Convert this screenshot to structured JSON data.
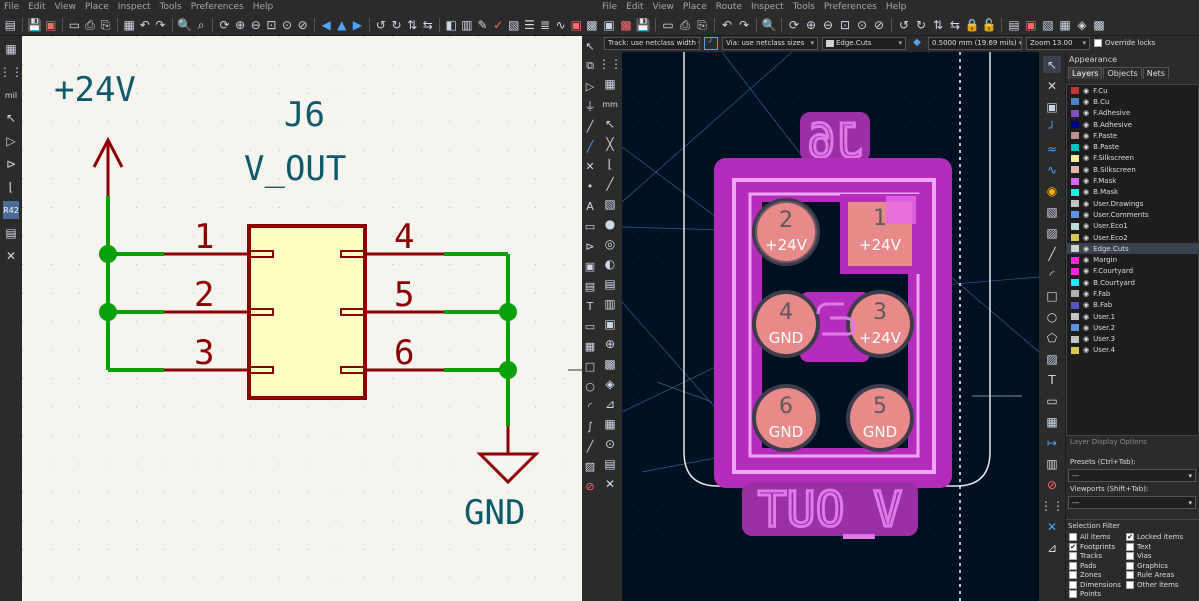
{
  "schematic": {
    "menu": [
      "File",
      "Edit",
      "View",
      "Place",
      "Inspect",
      "Tools",
      "Preferences",
      "Help"
    ],
    "power_label": "+24V",
    "ground_label": "GND",
    "ref": "J6",
    "value": "V_OUT",
    "pins": [
      "1",
      "2",
      "3",
      "4",
      "5",
      "6"
    ],
    "left_tools": [
      "grid-icon",
      "grid-dots-icon",
      "units-mil-icon",
      "cursor-icon",
      "pin-icon",
      "axis-icon",
      "erc-icon",
      "layers-icon",
      "tools-icon"
    ],
    "mil_label": "mil",
    "erc_label": "R42"
  },
  "pcb": {
    "menu": [
      "File",
      "Edit",
      "View",
      "Place",
      "Route",
      "Inspect",
      "Tools",
      "Preferences",
      "Help"
    ],
    "track_select": "Track: use netclass width",
    "via_select": "Via: use netclass sizes",
    "layer_select": "Edge.Cuts",
    "grid_select": "0.5000 mm (19.69 mils)",
    "zoom_select": "Zoom 13.00",
    "override_label": "Override locks",
    "silk_ref": "J6",
    "silk_value": "V_OUT",
    "pads": [
      {
        "num": "1",
        "net": "+24V"
      },
      {
        "num": "2",
        "net": "+24V"
      },
      {
        "num": "3",
        "net": "+24V"
      },
      {
        "num": "4",
        "net": "GND"
      },
      {
        "num": "5",
        "net": "GND"
      },
      {
        "num": "6",
        "net": "GND"
      }
    ],
    "colors": {
      "bg": "#001023",
      "magenta": "#c22fc6",
      "pad": "#e98a8a",
      "outline": "#f2f2f2"
    }
  },
  "appearance": {
    "title": "Appearance",
    "tabs": [
      "Layers",
      "Objects",
      "Nets"
    ],
    "layers": [
      {
        "name": "F.Cu",
        "color": "#c83434"
      },
      {
        "name": "B.Cu",
        "color": "#4d7fc4"
      },
      {
        "name": "F.Adhesive",
        "color": "#844cbe"
      },
      {
        "name": "B.Adhesive",
        "color": "#00008c"
      },
      {
        "name": "F.Paste",
        "color": "#b7928c"
      },
      {
        "name": "B.Paste",
        "color": "#00c2c2"
      },
      {
        "name": "F.Silkscreen",
        "color": "#f2eda1"
      },
      {
        "name": "B.Silkscreen",
        "color": "#e8b2a7"
      },
      {
        "name": "F.Mask",
        "color": "#d864ff"
      },
      {
        "name": "B.Mask",
        "color": "#02ffee"
      },
      {
        "name": "User.Drawings",
        "color": "#c2c2c2"
      },
      {
        "name": "User.Comments",
        "color": "#5994dc"
      },
      {
        "name": "User.Eco1",
        "color": "#b4dbd2"
      },
      {
        "name": "User.Eco2",
        "color": "#d8c852"
      },
      {
        "name": "Edge.Cuts",
        "color": "#d0d2cd"
      },
      {
        "name": "Margin",
        "color": "#ff26e2"
      },
      {
        "name": "F.Courtyard",
        "color": "#ff26e2"
      },
      {
        "name": "B.Courtyard",
        "color": "#26e9ff"
      },
      {
        "name": "F.Fab",
        "color": "#afafaf"
      },
      {
        "name": "B.Fab",
        "color": "#5854c8"
      },
      {
        "name": "User.1",
        "color": "#c2c2c2"
      },
      {
        "name": "User.2",
        "color": "#5994dc"
      },
      {
        "name": "User.3",
        "color": "#c2c2c2"
      },
      {
        "name": "User.4",
        "color": "#d8c852"
      }
    ],
    "highlighted_layer": "Edge.Cuts",
    "layer_display_options": "Layer Display Options",
    "presets_label": "Presets (Ctrl+Tab):",
    "presets_value": "---",
    "viewports_label": "Viewports (Shift+Tab):",
    "viewports_value": "---",
    "selection_filter": "Selection Filter",
    "filters": [
      {
        "label": "All items",
        "checked": false
      },
      {
        "label": "Locked items",
        "checked": true
      },
      {
        "label": "Footprints",
        "checked": true
      },
      {
        "label": "Text",
        "checked": false
      },
      {
        "label": "Tracks",
        "checked": false
      },
      {
        "label": "Vias",
        "checked": false
      },
      {
        "label": "Pads",
        "checked": false
      },
      {
        "label": "Graphics",
        "checked": false
      },
      {
        "label": "Zones",
        "checked": false
      },
      {
        "label": "Rule Areas",
        "checked": false
      },
      {
        "label": "Dimensions",
        "checked": false
      },
      {
        "label": "Other items",
        "checked": false
      },
      {
        "label": "Points",
        "checked": false
      }
    ]
  }
}
